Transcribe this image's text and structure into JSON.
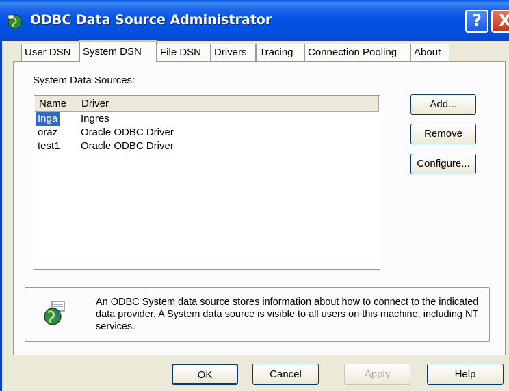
{
  "window": {
    "title": "ODBC Data Source Administrator",
    "help_glyph": "?",
    "close_glyph": "X"
  },
  "tabs": [
    {
      "label": "User DSN"
    },
    {
      "label": "System DSN"
    },
    {
      "label": "File DSN"
    },
    {
      "label": "Drivers"
    },
    {
      "label": "Tracing"
    },
    {
      "label": "Connection Pooling"
    },
    {
      "label": "About"
    }
  ],
  "panel": {
    "sources_label": "System Data Sources:",
    "columns": [
      "Name",
      "Driver"
    ],
    "rows": [
      {
        "name": "Inga",
        "driver": "Ingres",
        "selected": true
      },
      {
        "name": "oraz",
        "driver": "Oracle ODBC Driver",
        "selected": false
      },
      {
        "name": "test1",
        "driver": "Oracle ODBC Driver",
        "selected": false
      }
    ],
    "buttons": {
      "add": "Add...",
      "remove": "Remove",
      "configure": "Configure..."
    },
    "info_text": "An ODBC System data source stores information about how to connect to the indicated data provider.  A System data source is visible to all users on this machine, including NT services."
  },
  "footer": {
    "ok": "OK",
    "cancel": "Cancel",
    "apply": "Apply",
    "help": "Help"
  },
  "colors": {
    "titlebar": "#0454e6",
    "selection": "#316ac5",
    "tab_highlight": "#ffc83c"
  },
  "icons": {
    "title": "odbc-globe-icon",
    "info": "odbc-globe-icon"
  }
}
